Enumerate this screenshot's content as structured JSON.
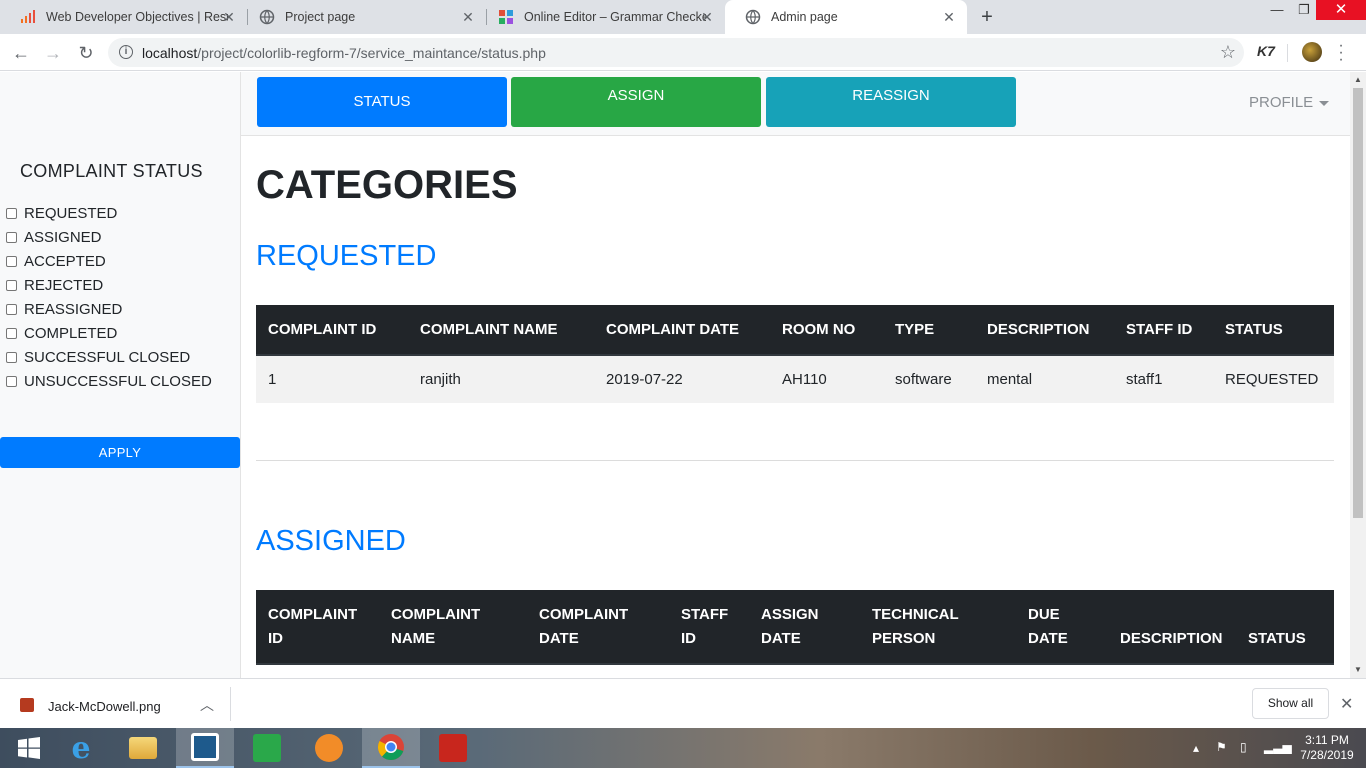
{
  "browser": {
    "tabs": [
      {
        "title": "Web Developer Objectives | Resu",
        "icon": "chart-icon"
      },
      {
        "title": "Project page",
        "icon": "globe-icon"
      },
      {
        "title": "Online Editor – Grammar Checke",
        "icon": "grid-icon"
      },
      {
        "title": "Admin page",
        "icon": "globe-icon"
      }
    ],
    "new_tab": "+",
    "url_host": "localhost",
    "url_path": "/project/colorlib-regform-7/service_maintance/status.php",
    "ext_label": "K7"
  },
  "sidebar": {
    "title": "COMPLAINT STATUS",
    "filters": [
      "REQUESTED",
      "ASSIGNED",
      "ACCEPTED",
      "REJECTED",
      "REASSIGNED",
      "COMPLETED",
      "SUCCESSFUL CLOSED",
      "UNSUCCESSFUL CLOSED"
    ],
    "apply_label": "APPLY"
  },
  "topnav": {
    "status_label": "STATUS",
    "assign_label": "ASSIGN",
    "reassign_label": "REASSIGN",
    "profile_label": "PROFILE"
  },
  "main": {
    "heading": "CATEGORIES",
    "requested": {
      "title": "REQUESTED",
      "columns": [
        "COMPLAINT ID",
        "COMPLAINT NAME",
        "COMPLAINT DATE",
        "ROOM NO",
        "TYPE",
        "DESCRIPTION",
        "STAFF ID",
        "STATUS"
      ],
      "rows": [
        [
          "1",
          "ranjith",
          "2019-07-22",
          "AH110",
          "software",
          "mental",
          "staff1",
          "REQUESTED"
        ]
      ]
    },
    "assigned": {
      "title": "ASSIGNED",
      "columns": [
        [
          "COMPLAINT",
          "ID"
        ],
        [
          "COMPLAINT",
          "NAME"
        ],
        [
          "COMPLAINT",
          "DATE"
        ],
        [
          "STAFF",
          "ID"
        ],
        [
          "ASSIGN",
          "DATE"
        ],
        [
          "TECHNICAL",
          "PERSON"
        ],
        [
          "DUE",
          "DATE"
        ],
        [
          "",
          "DESCRIPTION"
        ],
        [
          "",
          "STATUS"
        ]
      ]
    }
  },
  "download_shelf": {
    "file_name": "Jack-McDowell.png",
    "show_all_label": "Show all"
  },
  "taskbar": {
    "time": "3:11 PM",
    "date": "7/28/2019"
  },
  "colors": {
    "primary": "#007bff",
    "success": "#28a745",
    "info": "#17a2b8",
    "dark": "#212529"
  }
}
